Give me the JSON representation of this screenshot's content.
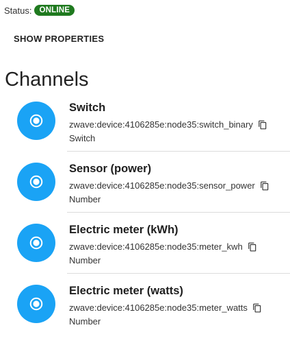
{
  "status": {
    "label": "Status:",
    "badge": "ONLINE",
    "badge_color": "#1f7a1f"
  },
  "show_properties_label": "SHOW PROPERTIES",
  "channels_title": "Channels",
  "accent_color": "#1aa3f5",
  "channels": [
    {
      "label": "Switch",
      "uid": "zwave:device:4106285e:node35:switch_binary",
      "type": "Switch",
      "icon": "radio-button-checked-icon",
      "copy_icon": "copy-icon"
    },
    {
      "label": "Sensor (power)",
      "uid": "zwave:device:4106285e:node35:sensor_power",
      "type": "Number",
      "icon": "radio-button-checked-icon",
      "copy_icon": "copy-icon"
    },
    {
      "label": "Electric meter (kWh)",
      "uid": "zwave:device:4106285e:node35:meter_kwh",
      "type": "Number",
      "icon": "radio-button-checked-icon",
      "copy_icon": "copy-icon"
    },
    {
      "label": "Electric meter (watts)",
      "uid": "zwave:device:4106285e:node35:meter_watts",
      "type": "Number",
      "icon": "radio-button-checked-icon",
      "copy_icon": "copy-icon"
    }
  ]
}
